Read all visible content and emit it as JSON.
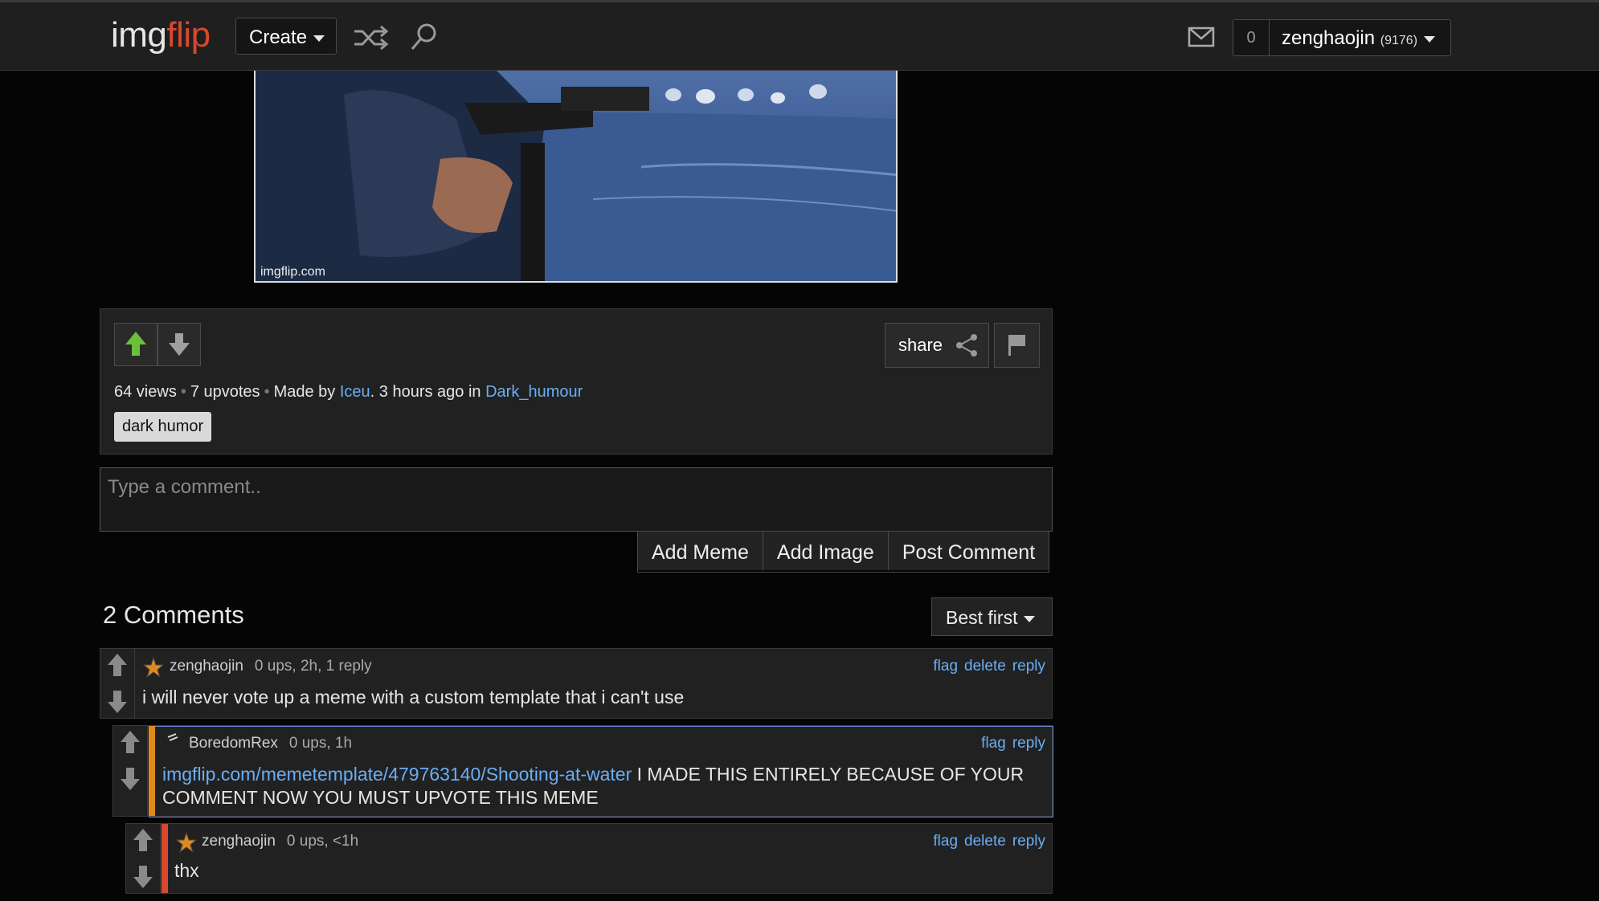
{
  "header": {
    "logo_img": "img",
    "logo_flip": "flip",
    "create_label": "Create",
    "notif_count": "0",
    "username": "zenghaojin",
    "user_points": "(9176)"
  },
  "meme": {
    "watermark": "imgflip.com",
    "share_label": "share",
    "views": "64 views",
    "upvotes": "7 upvotes",
    "made_by_prefix": "Made by",
    "author": "Iceu",
    "time_text": ". 3 hours ago in",
    "stream": "Dark_humour",
    "tag": "dark humor"
  },
  "comment_form": {
    "placeholder": "Type a comment..",
    "add_meme": "Add Meme",
    "add_image": "Add Image",
    "post_comment": "Post Comment"
  },
  "comments_header": {
    "count_label": "2 Comments",
    "sort_label": "Best first"
  },
  "comments": [
    {
      "user": "zenghaojin",
      "meta": "0 ups, 2h, 1 reply",
      "text": "i will never vote up a meme with a custom template that i can't use",
      "flag": "flag",
      "delete": "delete",
      "reply": "reply"
    },
    {
      "user": "BoredomRex",
      "meta": "0 ups, 1h",
      "link": "imgflip.com/memetemplate/479763140/Shooting-at-water",
      "text": " I MADE THIS ENTIRELY BECAUSE OF YOUR COMMENT NOW YOU MUST UPVOTE THIS MEME",
      "flag": "flag",
      "reply": "reply"
    },
    {
      "user": "zenghaojin",
      "meta": "0 ups, <1h",
      "text": "thx",
      "flag": "flag",
      "delete": "delete",
      "reply": "reply"
    }
  ],
  "colors": {
    "link": "#6aaef5",
    "logo_accent": "#d9482b",
    "upvote_active": "#6bbf3a",
    "reply_accent_orange": "#e08a1e",
    "reply_accent_red": "#d9482b"
  }
}
